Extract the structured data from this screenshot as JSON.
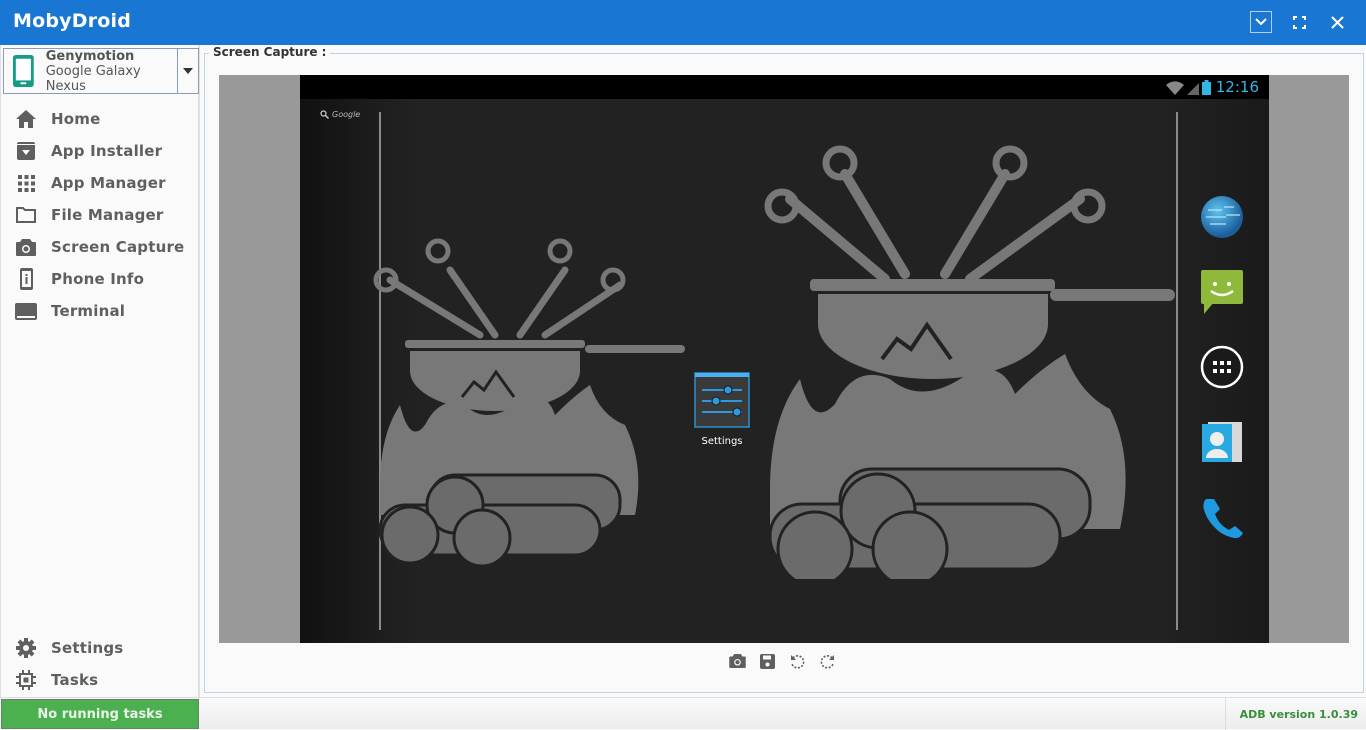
{
  "window": {
    "title": "MobyDroid",
    "buttons": {
      "minimize": "chevron-down",
      "maximize": "fullscreen",
      "close": "close"
    }
  },
  "device": {
    "name": "Genymotion",
    "model": "Google Galaxy Nexus",
    "icon": "smartphone-icon",
    "accent": "#159b87"
  },
  "sidebar": {
    "items": [
      {
        "label": "Home",
        "icon": "home-icon"
      },
      {
        "label": "App Installer",
        "icon": "download-box-icon"
      },
      {
        "label": "App Manager",
        "icon": "apps-grid-icon"
      },
      {
        "label": "File Manager",
        "icon": "folder-icon"
      },
      {
        "label": "Screen Capture",
        "icon": "camera-icon"
      },
      {
        "label": "Phone Info",
        "icon": "phone-info-icon"
      },
      {
        "label": "Terminal",
        "icon": "terminal-icon"
      }
    ],
    "bottom_items": [
      {
        "label": "Settings",
        "icon": "gear-icon"
      },
      {
        "label": "Tasks",
        "icon": "chip-icon"
      }
    ]
  },
  "main": {
    "section_title": "Screen Capture :",
    "phone_screen": {
      "clock": "12:16",
      "search_label": "Google",
      "desktop_app": "Settings",
      "dock_apps": [
        "Browser",
        "Messaging",
        "All Apps",
        "People",
        "Phone"
      ]
    },
    "tools": [
      "camera-icon",
      "save-icon",
      "rotate-left-icon",
      "rotate-right-icon"
    ]
  },
  "footer": {
    "tasks_status": "No running tasks",
    "adb_version": "ADB version 1.0.39",
    "colors": {
      "tasks_bg": "#4caf50",
      "adb_text": "#388e3c"
    }
  },
  "colors": {
    "titlebar": "#1976d2",
    "clock": "#33b5e5"
  }
}
